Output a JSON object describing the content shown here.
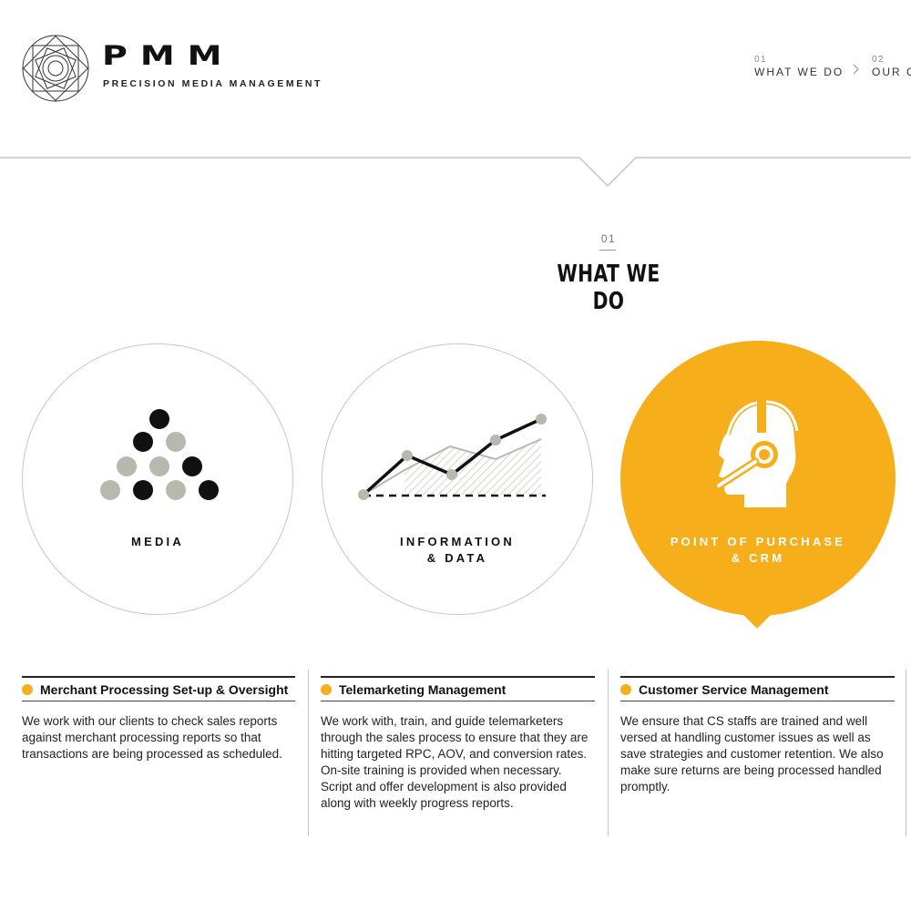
{
  "brand": {
    "name": "PMM",
    "subtitle": "PRECISION MEDIA MANAGEMENT"
  },
  "nav": [
    {
      "num": "01",
      "label": "WHAT WE DO"
    },
    {
      "num": "02",
      "label": "OUR CLIENTS"
    }
  ],
  "section": {
    "num": "01",
    "title": "WHAT WE DO"
  },
  "circles": [
    {
      "label_line1": "MEDIA",
      "label_line2": "",
      "icon": "pyramid-dots-icon",
      "active": false
    },
    {
      "label_line1": "INFORMATION",
      "label_line2": "& DATA",
      "icon": "line-graph-icon",
      "active": false
    },
    {
      "label_line1": "POINT OF PURCHASE",
      "label_line2": "& CRM",
      "icon": "headset-operator-icon",
      "active": true
    }
  ],
  "services": [
    {
      "title": "Merchant Processing Set-up & Oversight",
      "body": "We work with our clients to check sales reports against merchant processing reports so that transactions are being processed as scheduled."
    },
    {
      "title": "Telemarketing Management",
      "body": "We work with, train, and guide telemarketers through the sales process to ensure that they are hitting targeted RPC, AOV, and conversion rates. On-site training is provided when necessary. Script and offer development is also provided along with weekly progress reports."
    },
    {
      "title": "Customer Service Management",
      "body": "We ensure that CS staffs are trained and well versed at handling customer issues as well as save strategies and customer retention. We also make sure returns are being processed handled promptly."
    }
  ],
  "colors": {
    "accent": "#f6ae1b",
    "border": "#c9c6bd",
    "text": "#111111"
  }
}
